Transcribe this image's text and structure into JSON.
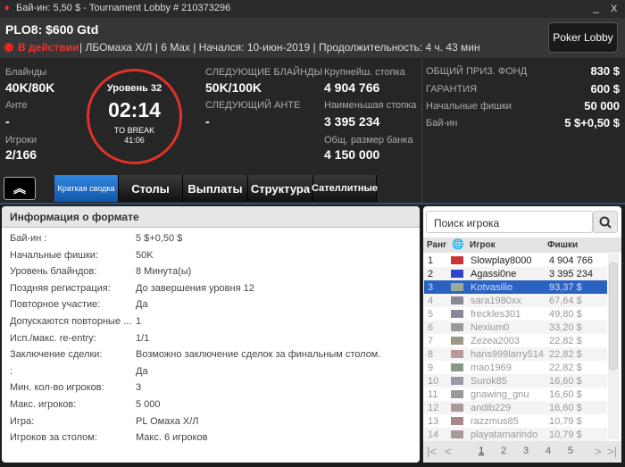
{
  "titlebar": {
    "title": "Бай-ин: 5,50 $ - Tournament Lobby # 210373296",
    "minimize": "_",
    "close": "X"
  },
  "header": {
    "name": "PLO8: $600 Gtd",
    "status": "В действии",
    "details": "| ЛБОмаха Х/Л | 6 Max | Начался: 10-июн-2019 | Продолжительность: 4 ч. 43 мин",
    "lobby_button": "Poker Lobby"
  },
  "stats": {
    "blinds_label": "Блайнды",
    "blinds": "40K/80K",
    "ante_label": "Анте",
    "ante": "-",
    "players_label": "Игроки",
    "players": "2/166",
    "level": "Уровень 32",
    "timer": "02:14",
    "to_break_label": "TO BREAK",
    "to_break": "41:06",
    "next_blinds_label": "СЛЕДУЮЩИЕ БЛАЙНДЫ",
    "next_blinds": "50K/100K",
    "next_ante_label": "СЛЕДУЮЩИЙ АНТЕ",
    "next_ante": "-",
    "largest_label": "Крупнейш. стопка",
    "largest": "4 904 766",
    "smallest_label": "Наименьшая стопка",
    "smallest": "3 395 234",
    "bank_label": "Общ. размер банка",
    "bank": "4 150 000"
  },
  "prize": [
    {
      "label": "ОБЩИЙ ПРИЗ. ФОНД",
      "value": "830 $"
    },
    {
      "label": "ГАРАНТИЯ",
      "value": "600 $"
    },
    {
      "label": "Начальные фишки",
      "value": "50 000"
    },
    {
      "label": "Бай-ин",
      "value": "5 $+0,50 $"
    }
  ],
  "tabs": [
    "Краткая сводка",
    "Столы",
    "Выплаты",
    "Структура",
    "Сателлитные"
  ],
  "format": {
    "title": "Информация о формате",
    "rows": [
      [
        "Бай-ин :",
        "5 $+0,50 $"
      ],
      [
        "Начальные фишки:",
        "50K"
      ],
      [
        "Уровень блайндов:",
        "8 Минута(ы)"
      ],
      [
        "Поздняя регистрация:",
        "До завершения уровня 12"
      ],
      [
        "Повторное участие:",
        "Да"
      ],
      [
        "Допускаются повторные ...",
        "1"
      ],
      [
        "Исп./макс. re-entry:",
        "1/1"
      ],
      [
        "Заключение сделки:",
        "Возможно заключение сделок за финальным столом."
      ],
      [
        ":",
        "Да"
      ],
      [
        "Мин. кол-во игроков:",
        "3"
      ],
      [
        "Макс. игроков:",
        "5 000"
      ],
      [
        "Игра:",
        "PL Омаха Х/Л"
      ],
      [
        "Игроков за столом:",
        "Макс. 6 игроков"
      ]
    ]
  },
  "players": {
    "search_placeholder": "Поиск игрока",
    "headers": {
      "rank": "Ранг",
      "player": "Игрок",
      "chips": "Фишки"
    },
    "rows": [
      {
        "rank": "1",
        "name": "Slowplay8000",
        "chips": "4 904 766",
        "flag": "#c33"
      },
      {
        "rank": "2",
        "name": "Agassi0ne",
        "chips": "3 395 234",
        "flag": "#34c"
      },
      {
        "rank": "3",
        "name": "Kotvasilio",
        "chips": "93,37 $",
        "flag": "#9a9"
      },
      {
        "rank": "4",
        "name": "sara1980xx",
        "chips": "67,64 $",
        "flag": "#889"
      },
      {
        "rank": "5",
        "name": "freckles301",
        "chips": "49,80 $",
        "flag": "#889"
      },
      {
        "rank": "6",
        "name": "Nexium0",
        "chips": "33,20 $",
        "flag": "#999"
      },
      {
        "rank": "7",
        "name": "Zezea2003",
        "chips": "22,82 $",
        "flag": "#998"
      },
      {
        "rank": "8",
        "name": "hans999larry514",
        "chips": "22,82 $",
        "flag": "#b99"
      },
      {
        "rank": "9",
        "name": "mao1969",
        "chips": "22,82 $",
        "flag": "#898"
      },
      {
        "rank": "10",
        "name": "Surok85",
        "chips": "16,60 $",
        "flag": "#99a"
      },
      {
        "rank": "11",
        "name": "gnawing_gnu",
        "chips": "16,60 $",
        "flag": "#999"
      },
      {
        "rank": "12",
        "name": "andib229",
        "chips": "16,60 $",
        "flag": "#a99"
      },
      {
        "rank": "13",
        "name": "razzmus85",
        "chips": "10,79 $",
        "flag": "#a88"
      },
      {
        "rank": "14",
        "name": "playatamarindo",
        "chips": "10,79 $",
        "flag": "#a99"
      }
    ],
    "pages": [
      "1",
      "2",
      "3",
      "4",
      "5"
    ]
  }
}
